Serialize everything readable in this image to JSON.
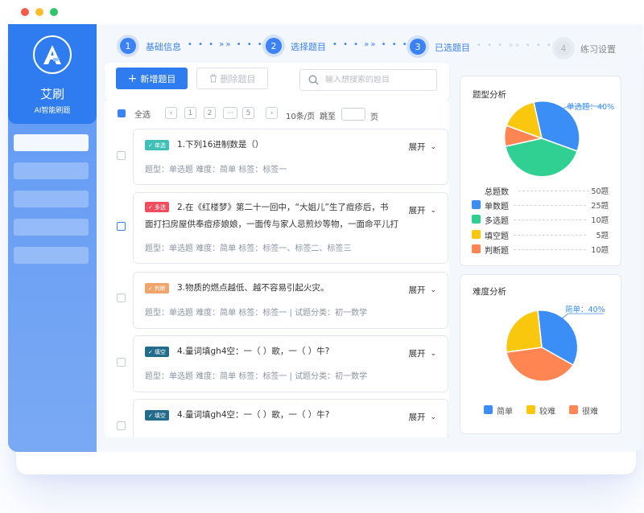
{
  "app": {
    "name": "艾刷",
    "subtitle": "AI智能刷题",
    "logo_letter": "A"
  },
  "window_dots": [
    "#f35a4a",
    "#fbbd2e",
    "#2fc46a"
  ],
  "stepper": {
    "steps": [
      {
        "num": "1",
        "label": "基础信息",
        "state": "done"
      },
      {
        "num": "2",
        "label": "选择题目",
        "state": "done"
      },
      {
        "num": "3",
        "label": "已选题目",
        "state": "current"
      },
      {
        "num": "4",
        "label": "练习设置",
        "state": "todo"
      }
    ],
    "connector": "• • • »» • • •"
  },
  "toolbar": {
    "add_label": "新增题目",
    "delete_label": "删除题目",
    "search_placeholder": "输入想搜索的题目"
  },
  "pagination": {
    "select_all": "全选",
    "pages": [
      "1",
      "2",
      "···",
      "5"
    ],
    "per_page": "10条/页",
    "jump_to": "跳至",
    "page_unit": "页"
  },
  "questions": [
    {
      "tag": "单选",
      "tag_color": "#3fbfb5",
      "title": "1.下列16进制数是（）",
      "meta": "题型：单选题    难度：简单    标签：标签一",
      "expand": "展开"
    },
    {
      "tag": "多选",
      "tag_color": "#f04e5e",
      "title_line1": "2.在《红楼梦》第二十一回中，“大姐儿”生了痘疹后，书",
      "title_line2": "面打扫房屋供奉痘疹娘娘，一面传与家人忌煎炒等物，一面命平儿打",
      "meta": "题型：单选题    难度：简单    标签：标签一、标签二、标签三",
      "expand": "展开"
    },
    {
      "tag": "判断",
      "tag_color": "#f0a469",
      "title": "3.物质的燃点越低、越不容易引起火灾。",
      "meta": "题型：单选题    难度：简单    标签：标签一  |  试题分类：初一数学",
      "expand": "展开"
    },
    {
      "tag": "填空",
      "tag_color": "#236b8a",
      "title": "4.量词填gh4空：一（    ）歌，一（    ）牛?",
      "meta": "题型：单选题    难度：简单    标签：标签一  |  试题分类：初一数学",
      "expand": "展开"
    },
    {
      "tag": "填空",
      "tag_color": "#236b8a",
      "title": "4.量词填gh4空：一（    ）歌，一（    ）牛?",
      "expand": "展开"
    }
  ],
  "type_analysis": {
    "title": "题型分析",
    "callout": "单选题：40%",
    "total_label": "总题数",
    "total_value": "50题",
    "rows": [
      {
        "label": "单数题",
        "value": "25题",
        "color": "#3a8ef6"
      },
      {
        "label": "多选题",
        "value": "10题",
        "color": "#2fd092"
      },
      {
        "label": "填空题",
        "value": "5题",
        "color": "#f9c80e"
      },
      {
        "label": "判断题",
        "value": "10题",
        "color": "#ff8552"
      }
    ]
  },
  "difficulty_analysis": {
    "title": "难度分析",
    "callout": "简单：40%",
    "legend": [
      {
        "label": "简单",
        "color": "#3a8ef6"
      },
      {
        "label": "较难",
        "color": "#f9c80e"
      },
      {
        "label": "很难",
        "color": "#ff8552"
      }
    ]
  }
}
